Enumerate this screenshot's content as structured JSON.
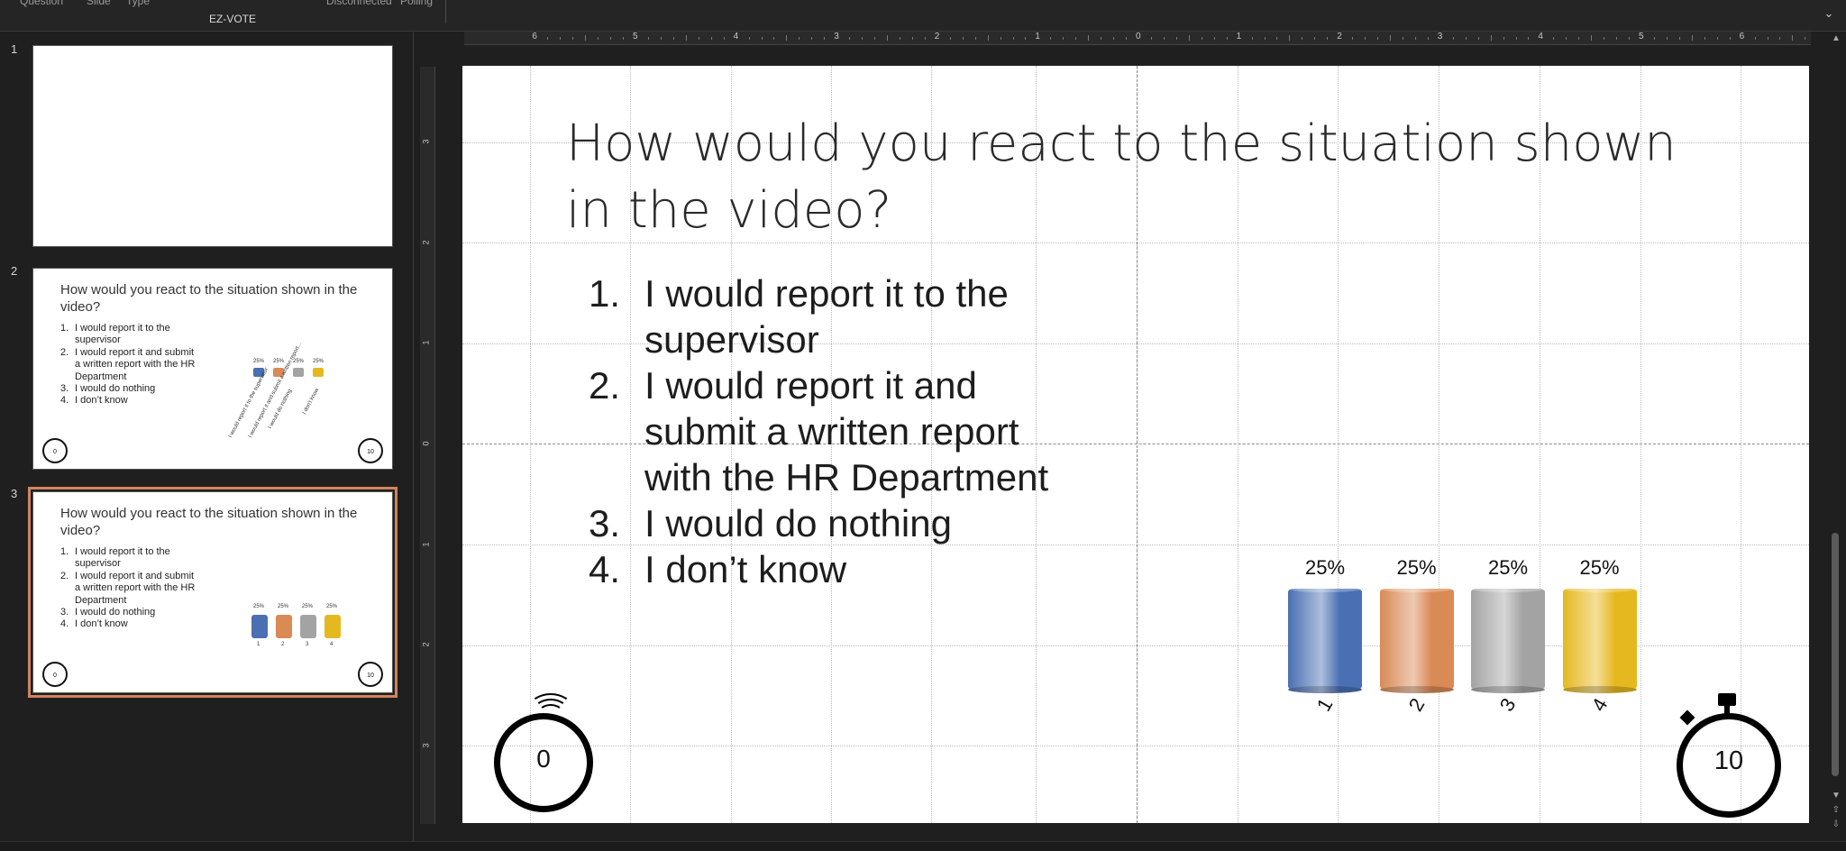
{
  "ribbon": {
    "fragments": [
      "Question",
      "Slide",
      "Type",
      "Disconnected",
      "Polling"
    ],
    "group_label": "EZ-VOTE"
  },
  "thumbnails": [
    {
      "number": "1"
    },
    {
      "number": "2",
      "title": "How would you react to the situation shown in the video?",
      "items": [
        {
          "n": "1.",
          "text": "I would report it to the supervisor"
        },
        {
          "n": "2.",
          "text": "I would report it and submit a written report with the HR Department"
        },
        {
          "n": "3.",
          "text": "I would do nothing"
        },
        {
          "n": "4.",
          "text": "I don’t know"
        }
      ],
      "percents": [
        "25%",
        "25%",
        "25%",
        "25%"
      ],
      "rotated_labels": [
        "I would report it to the supervisor",
        "I would report it and submit a written report...",
        "I would do nothing",
        "I don't know"
      ],
      "timer_left": "0",
      "timer_right": "10"
    },
    {
      "number": "3",
      "title": "How would you react to the situation shown in the video?",
      "items": [
        {
          "n": "1.",
          "text": "I would report it to the supervisor"
        },
        {
          "n": "2.",
          "text": "I would report it and submit a written report with the HR Department"
        },
        {
          "n": "3.",
          "text": "I would do nothing"
        },
        {
          "n": "4.",
          "text": "I don’t know"
        }
      ],
      "percents": [
        "25%",
        "25%",
        "25%",
        "25%"
      ],
      "bar_labels": [
        "1",
        "2",
        "3",
        "4"
      ],
      "timer_left": "0",
      "timer_right": "10"
    }
  ],
  "ruler": {
    "horizontal": [
      "6",
      "5",
      "4",
      "3",
      "2",
      "1",
      "0",
      "1",
      "2",
      "3",
      "4",
      "5",
      "6"
    ],
    "vertical": [
      "3",
      "2",
      "1",
      "0",
      "1",
      "2",
      "3"
    ]
  },
  "slide": {
    "title": "How would you react to the situation shown in the video?",
    "items": [
      {
        "n": "1.",
        "text": "I would report it to the supervisor"
      },
      {
        "n": "2.",
        "text": "I would report it and submit a written report with the HR Department"
      },
      {
        "n": "3.",
        "text": "I would do nothing"
      },
      {
        "n": "4.",
        "text": "I don’t know"
      }
    ],
    "timer_left": "0",
    "timer_right": "10"
  },
  "chart_data": {
    "type": "bar",
    "categories": [
      "1",
      "2",
      "3",
      "4"
    ],
    "values": [
      25,
      25,
      25,
      25
    ],
    "data_labels": [
      "25%",
      "25%",
      "25%",
      "25%"
    ],
    "colors": [
      "#4a6fb3",
      "#d98a55",
      "#a3a3a3",
      "#e6b820"
    ]
  }
}
